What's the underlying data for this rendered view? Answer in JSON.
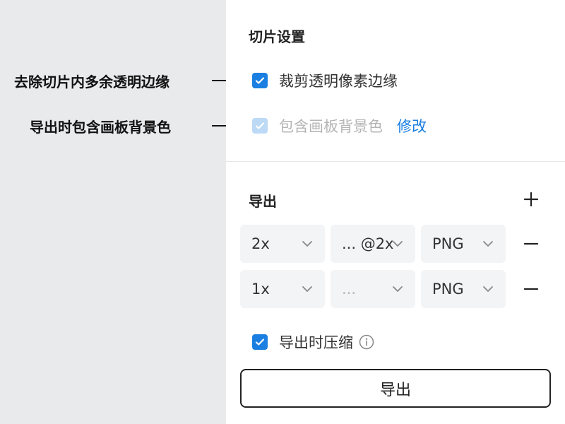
{
  "annotations": {
    "trim_text": "去除切片内多余透明边缘",
    "bg_text": "导出时包含画板背景色"
  },
  "slice_settings": {
    "title": "切片设置",
    "trim_label": "裁剪透明像素边缘",
    "include_bg_label": "包含画板背景色",
    "modify_link": "修改"
  },
  "export": {
    "title": "导出",
    "rows": [
      {
        "scale": "2x",
        "suffix": "... @2x",
        "format": "PNG"
      },
      {
        "scale": "1x",
        "suffix": "...",
        "format": "PNG"
      }
    ],
    "compress_label": "导出时压缩",
    "button_label": "导出"
  },
  "colors": {
    "accent": "#1a7fe0",
    "accent_disabled": "#bcd9f5",
    "side_bg": "#e9eaec"
  },
  "icons": [
    "check-icon",
    "plus-icon",
    "minus-icon",
    "chevron-down-icon",
    "info-icon"
  ]
}
